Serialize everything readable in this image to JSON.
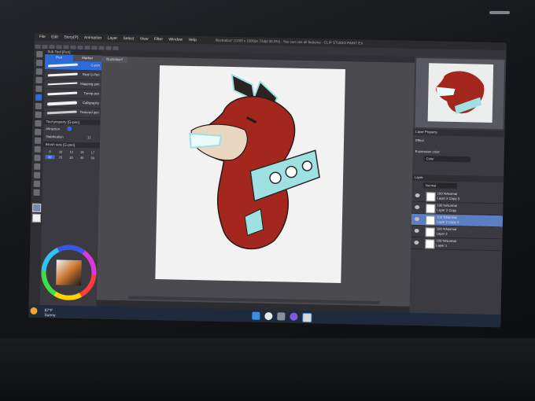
{
  "window": {
    "title": "Illustration* (1200 x 1600px 72dpi 35.0%) - You can use all features - CLIP STUDIO PAINT EX",
    "document_tab": "Illustration*"
  },
  "menubar": {
    "items": [
      "File",
      "Edit",
      "Story(P)",
      "Animation",
      "Layer",
      "Select",
      "View",
      "Filter",
      "Window",
      "Help"
    ]
  },
  "subtool_panel": {
    "header": "Sub Tool [Pen]",
    "tabs": [
      "Pen",
      "Marker"
    ],
    "brushes": [
      "G-pen",
      "Real G-Pen",
      "Mapping pen",
      "Turnip pen",
      "Calligraphy",
      "Textured pen"
    ],
    "property_header": "Tool property [G-pen]",
    "property_label": "Attraction",
    "stabilization_label": "Stabilization",
    "stabilization_value": "11"
  },
  "brush_size": {
    "header": "Brush size [G-pen]",
    "sizes": [
      "8",
      "10",
      "12",
      "15",
      "17",
      "20",
      "25",
      "30",
      "40",
      "50"
    ]
  },
  "color": {
    "wheel_label": "Color"
  },
  "layer_property": {
    "tab": "Layer Property",
    "effect_label": "Effect",
    "expression_label": "Expression color",
    "expression_value": "Color"
  },
  "layers": {
    "header": "Layer",
    "blend": "Normal",
    "items": [
      {
        "opacity": "100 %Normal",
        "name": "Layer 2 Copy 3",
        "selected": false
      },
      {
        "opacity": "100 %Normal",
        "name": "Layer 2 Copy",
        "selected": false
      },
      {
        "opacity": "100 %Normal",
        "name": "Layer 2 Copy 2",
        "selected": true
      },
      {
        "opacity": "100 %Normal",
        "name": "Layer 2",
        "selected": false
      },
      {
        "opacity": "100 %Normal",
        "name": "Layer 1",
        "selected": false
      }
    ]
  },
  "taskbar": {
    "weather_temp": "87°F",
    "weather_desc": "Sunny"
  },
  "colors": {
    "accent": "#2f6bd8",
    "fur_red": "#a3271c",
    "collar": "#9fe1e2",
    "cream": "#ead7c1"
  }
}
